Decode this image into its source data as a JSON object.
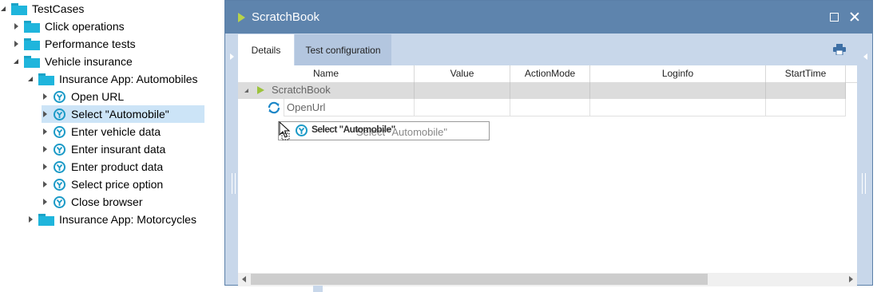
{
  "tree": {
    "items": [
      {
        "label": "TestCases",
        "level": 0,
        "expanded": true,
        "type": "folder"
      },
      {
        "label": "Click operations",
        "level": 1,
        "expanded": false,
        "type": "folder"
      },
      {
        "label": "Performance tests",
        "level": 1,
        "expanded": false,
        "type": "folder"
      },
      {
        "label": "Vehicle insurance",
        "level": 1,
        "expanded": true,
        "type": "folder"
      },
      {
        "label": "Insurance App: Automobiles",
        "level": 2,
        "expanded": true,
        "type": "folder"
      },
      {
        "label": "Open URL",
        "level": 3,
        "expanded": false,
        "type": "testcase"
      },
      {
        "label": "Select \"Automobile\"",
        "level": 3,
        "expanded": false,
        "type": "testcase",
        "selected": true
      },
      {
        "label": "Enter vehicle data",
        "level": 3,
        "expanded": false,
        "type": "testcase"
      },
      {
        "label": "Enter insurant data",
        "level": 3,
        "expanded": false,
        "type": "testcase"
      },
      {
        "label": "Enter product data",
        "level": 3,
        "expanded": false,
        "type": "testcase"
      },
      {
        "label": "Select price option",
        "level": 3,
        "expanded": false,
        "type": "testcase"
      },
      {
        "label": "Close browser",
        "level": 3,
        "expanded": false,
        "type": "testcase"
      },
      {
        "label": "Insurance App: Motorcycles",
        "level": 2,
        "expanded": false,
        "type": "folder"
      }
    ]
  },
  "window": {
    "title": "ScratchBook",
    "tabs": [
      {
        "label": "Details",
        "active": true
      },
      {
        "label": "Test configuration",
        "active": false
      }
    ],
    "columns": [
      "Name",
      "Value",
      "ActionMode",
      "Loginfo",
      "StartTime"
    ],
    "rows": [
      {
        "name": "ScratchBook",
        "icon": "play-icon"
      },
      {
        "name": "OpenUrl",
        "icon": "refresh-icon"
      }
    ],
    "drag_ghost": {
      "text": "Select \"Automobile\"",
      "overlay_text": "Select \"Automobile\""
    }
  },
  "colors": {
    "titlebar": "#5e84ad",
    "frame": "#c8d7ea",
    "folder": "#1fb5dc",
    "selection": "#cce4f7",
    "play_green": "#9cc33b"
  }
}
